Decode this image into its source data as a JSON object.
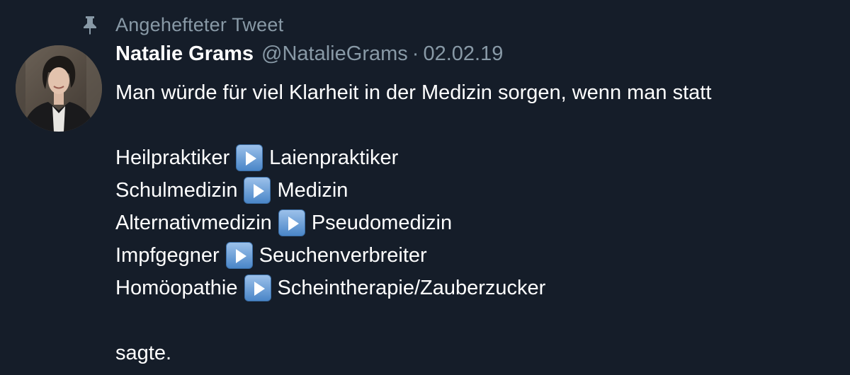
{
  "pinned": {
    "icon": "pin-icon",
    "label": "Angehefteter Tweet"
  },
  "author": {
    "avatar": "avatar",
    "display_name": "Natalie Grams",
    "handle": "@NatalieGrams",
    "separator": "·",
    "date": "02.02.19"
  },
  "tweet": {
    "intro": "Man würde für viel Klarheit in der Medizin sorgen, wenn man statt",
    "arrow_icon": "play-button-emoji-icon",
    "replacements": [
      {
        "from": "Heilpraktiker",
        "to": "Laienpraktiker"
      },
      {
        "from": "Schulmedizin",
        "to": "Medizin"
      },
      {
        "from": "Alternativmedizin",
        "to": "Pseudomedizin"
      },
      {
        "from": "Impfgegner",
        "to": "Seuchenverbreiter"
      },
      {
        "from": "Homöopathie",
        "to": "Scheintherapie/Zauberzucker"
      }
    ],
    "outro": "sagte."
  },
  "colors": {
    "background": "#151d29",
    "text": "#ffffff",
    "muted": "#8899a6"
  }
}
